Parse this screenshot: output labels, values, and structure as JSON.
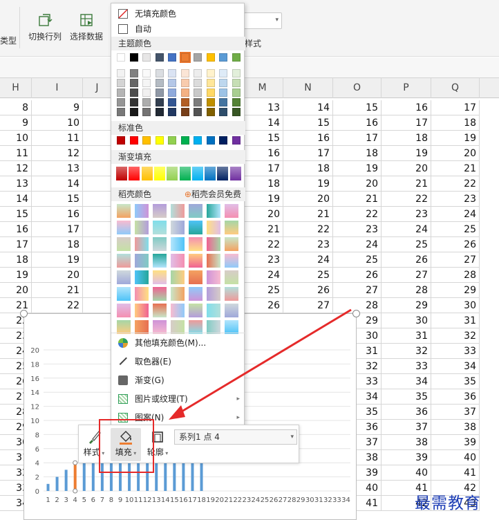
{
  "ribbon": {
    "partial_left_label": "类型",
    "switch_row_col": "切换行列",
    "select_data": "选择数据",
    "style_label": "样式"
  },
  "grid": {
    "columns": [
      "H",
      "I",
      "J",
      "K",
      "L",
      "M",
      "N",
      "O",
      "P",
      "Q"
    ],
    "first_value_col_h": 8
  },
  "color_menu": {
    "no_fill": "无填充颜色",
    "auto": "自动",
    "theme_colors_title": "主题颜色",
    "standard_colors_title": "标准色",
    "gradient_fill_title": "渐变填充",
    "docer_colors_title": "稻壳颜色",
    "docer_member_free": "稻壳会员免费",
    "theme_colors_row1": [
      "#ffffff",
      "#000000",
      "#e7e6e6",
      "#44546a",
      "#4472c4",
      "#ed7d31",
      "#a5a5a5",
      "#ffc000",
      "#5b9bd5",
      "#70ad47"
    ],
    "standard_colors": [
      "#c00000",
      "#ff0000",
      "#ffc000",
      "#ffff00",
      "#92d050",
      "#00b050",
      "#00b0f0",
      "#0070c0",
      "#002060",
      "#7030a0"
    ],
    "items": [
      {
        "label": "其他填充颜色(M)...",
        "icon": "palette-icon",
        "has_submenu": false
      },
      {
        "label": "取色器(E)",
        "icon": "eyedropper-icon",
        "has_submenu": false
      },
      {
        "label": "渐变(G)",
        "icon": "gradient-icon",
        "has_submenu": false
      },
      {
        "label": "图片或纹理(T)",
        "icon": "texture-icon",
        "has_submenu": true
      },
      {
        "label": "图案(N)",
        "icon": "pattern-icon",
        "has_submenu": true
      }
    ]
  },
  "mini_toolbar": {
    "style_label": "样式",
    "fill_label": "填充",
    "outline_label": "轮廓",
    "series_select_value": "系列1 点 4"
  },
  "chart_data": {
    "type": "bar",
    "categories": [
      "1",
      "2",
      "3",
      "4",
      "5",
      "6",
      "7",
      "8",
      "9",
      "10",
      "11",
      "12",
      "13",
      "14",
      "15",
      "16",
      "17",
      "18",
      "19",
      "20",
      "21",
      "22",
      "23",
      "24",
      "25",
      "26",
      "27",
      "28",
      "29",
      "30",
      "31",
      "32",
      "33",
      "34"
    ],
    "values": [
      1,
      2,
      3,
      4,
      4,
      4,
      4,
      4,
      4,
      4,
      4,
      4,
      4,
      4,
      4,
      4,
      4,
      4,
      0,
      0,
      0,
      0,
      0,
      0,
      0,
      0,
      0,
      0,
      0,
      0,
      0,
      0,
      0,
      0
    ],
    "y_ticks": [
      "0",
      "2",
      "4",
      "6",
      "8",
      "10",
      "12",
      "14",
      "16",
      "18",
      "20"
    ],
    "ylim": [
      0,
      20
    ],
    "grid": true,
    "bar_color": "#5b9bd5",
    "selected_point_index": 3,
    "selected_color": "#ed7d31"
  },
  "watermark": "最需教育"
}
